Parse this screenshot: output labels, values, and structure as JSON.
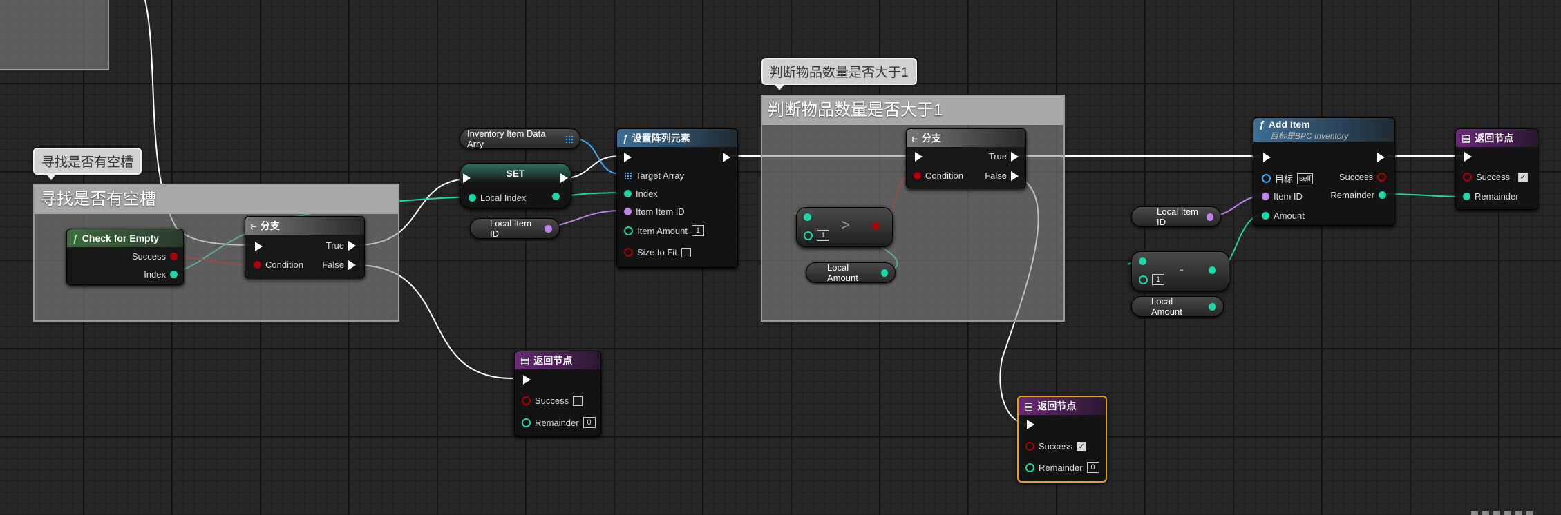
{
  "comments": {
    "find_empty": "寻找是否有空槽",
    "check_amount": "判断物品数量是否大于1"
  },
  "nodes": {
    "check_for_empty": {
      "title": "Check for Empty",
      "success": "Success",
      "index": "Index"
    },
    "branch1": {
      "title": "分支",
      "condition": "Condition",
      "true_label": "True",
      "false_label": "False"
    },
    "inventory_var": {
      "label": "Inventory Item Data Arry"
    },
    "set_node": {
      "title": "SET",
      "local_index": "Local Index"
    },
    "local_item_id_1": {
      "label": "Local Item ID"
    },
    "set_array_elem": {
      "title": "设置阵列元素",
      "target_array": "Target Array",
      "index": "Index",
      "item_item_id": "Item Item ID",
      "item_amount": "Item Amount",
      "item_amount_value": "1",
      "size_to_fit": "Size to Fit"
    },
    "return1": {
      "title": "返回节点",
      "success": "Success",
      "remainder": "Remainder",
      "remainder_value": "0",
      "success_checked": false
    },
    "greater": {
      "op": ">",
      "value": "1"
    },
    "local_amount_1": {
      "label": "Local Amount"
    },
    "branch2": {
      "title": "分支",
      "condition": "Condition",
      "true_label": "True",
      "false_label": "False"
    },
    "return2": {
      "title": "返回节点",
      "success": "Success",
      "remainder": "Remainder",
      "remainder_value": "0",
      "success_checked": true
    },
    "local_item_id_2": {
      "label": "Local Item ID"
    },
    "minus": {
      "op": "-",
      "value": "1"
    },
    "local_amount_2": {
      "label": "Local Amount"
    },
    "add_item": {
      "title": "Add Item",
      "subtitle": "目标是BPC Inventory",
      "target": "目标",
      "target_value": "self",
      "item_id": "Item ID",
      "amount": "Amount",
      "success": "Success",
      "remainder": "Remainder"
    },
    "return3": {
      "title": "返回节点",
      "success": "Success",
      "remainder": "Remainder",
      "success_checked": true
    }
  },
  "colors": {
    "exec": "#ffffff",
    "int_pin": "#19d9a8",
    "bool_pin": "#b00000",
    "name_pin": "#c080f0",
    "array_pin": "#35aaff",
    "func_header": "#3d6e96",
    "pure_header": "#3f6b3f",
    "return_header": "#6a2a78",
    "selected_border": "#f0a000"
  },
  "icons": [
    "function-icon",
    "branch-icon",
    "return-node-icon",
    "array-grid-icon",
    "exec-pin-icon",
    "checkbox-icon"
  ]
}
